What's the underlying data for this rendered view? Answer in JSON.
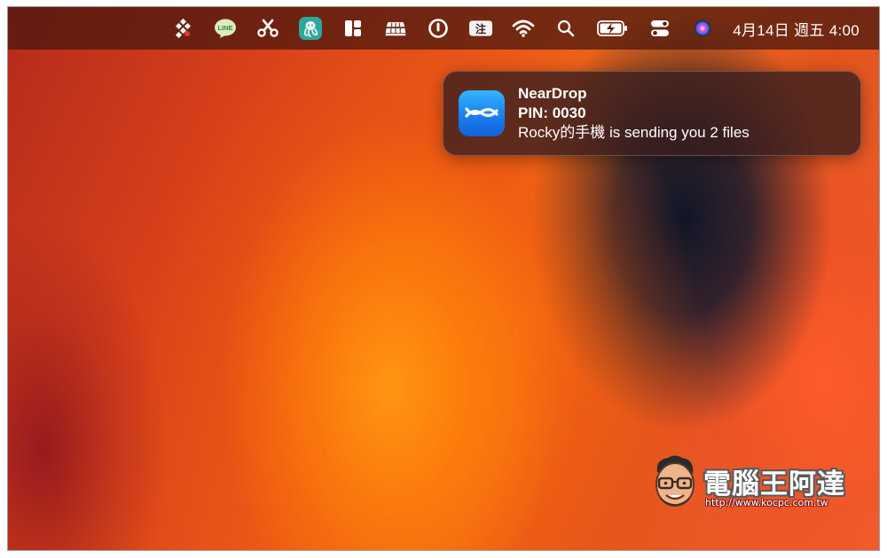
{
  "menubar": {
    "icons": [
      "dropbox-like-icon",
      "line-icon",
      "scissors-icon",
      "octopus-app-icon",
      "layout-icon",
      "keyboard-stack-icon",
      "power-ring-icon",
      "input-method-icon",
      "wifi-icon",
      "search-icon",
      "battery-charging-icon",
      "control-center-icon",
      "siri-icon"
    ],
    "line_label": "LINE",
    "input_method_label": "注",
    "clock": "4月14日 週五  4:00"
  },
  "notification": {
    "app_name": "NearDrop",
    "pin": "PIN: 0030",
    "body": "Rocky的手機 is sending you 2 files",
    "icon": "neardrop-app-icon"
  },
  "watermark": {
    "text": "電腦王阿達",
    "url": "http://www.kocpc.com.tw"
  },
  "colors": {
    "accent": "#1a7ff0",
    "menubar": "#46160e"
  }
}
